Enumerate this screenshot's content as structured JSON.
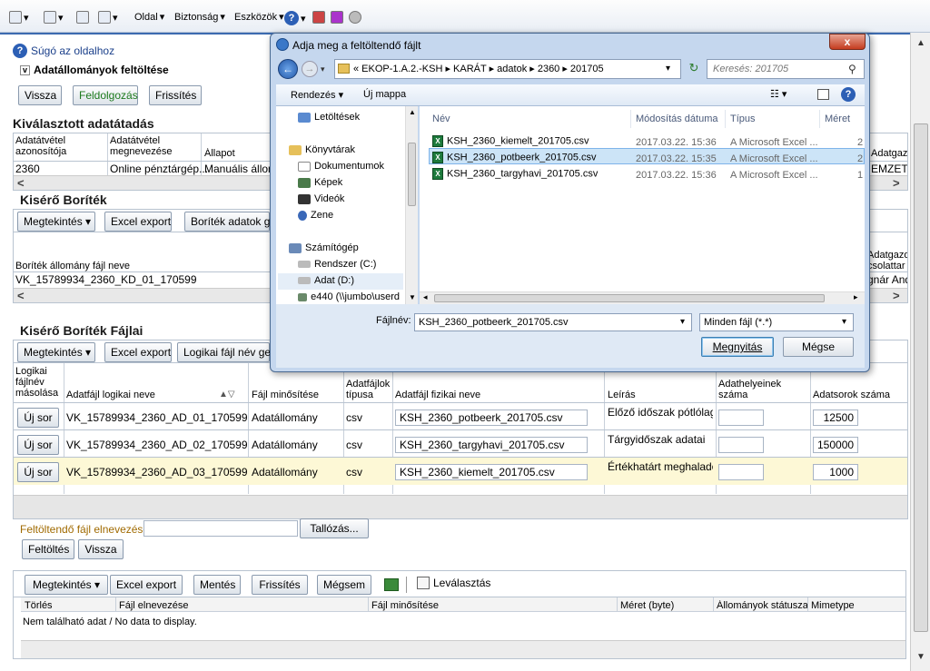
{
  "ie_toolbar": {
    "menus": [
      "Oldal",
      "Biztonság",
      "Eszközök"
    ]
  },
  "page": {
    "help_link": "Súgó az oldalhoz",
    "section_title": "Adatállományok feltöltése",
    "top_buttons": [
      "Vissza",
      "Feldolgozás",
      "Frissítés"
    ],
    "selected": {
      "title": "Kiválasztott adatátadás",
      "headers": [
        "Adatátvétel azonosítója",
        "Adatátvétel megnevezése",
        "Állapot",
        "Adatgazd"
      ],
      "row": [
        "2360",
        "Online pénztárgép...",
        "Manuális állom",
        "EMZETI"
      ]
    },
    "kisero": {
      "title": "Kisérő Boríték",
      "buttons": [
        "Megtekintés ▾",
        "Excel export",
        "Boríték adatok ge"
      ],
      "header": "Boríték állomány fájl neve",
      "header_right": "Adatgazda csolattar",
      "row": "VK_15789934_2360_KD_01_170599",
      "row_right": "gnár And"
    },
    "fajlai": {
      "title": "Kisérő Boríték Fájlai",
      "buttons": [
        "Megtekintés ▾",
        "Excel export",
        "Logikai fájl név gen"
      ],
      "headers": [
        "Logikai fájlnév másolása",
        "Adatfájl logikai neve",
        "Fájl minősítése",
        "Adatfájlok típusa",
        "Adatfájl fizikai neve",
        "Leírás",
        "Adathelyeinek száma",
        "Adatsorok száma"
      ],
      "rows": [
        {
          "btn": "Új sor",
          "logical": "VK_15789934_2360_AD_01_170599",
          "qual": "Adatállomány",
          "type": "csv",
          "physical": "KSH_2360_potbeerk_201705.csv",
          "desc": "Előző időszak pótlólagos",
          "places": "",
          "count": "12500"
        },
        {
          "btn": "Új sor",
          "logical": "VK_15789934_2360_AD_02_170599",
          "qual": "Adatállomány",
          "type": "csv",
          "physical": "KSH_2360_targyhavi_201705.csv",
          "desc": "Tárgyidőszak adatai",
          "places": "",
          "count": "150000"
        },
        {
          "btn": "Új sor",
          "logical": "VK_15789934_2360_AD_03_170599",
          "qual": "Adatállomány",
          "type": "csv",
          "physical": "KSH_2360_kiemelt_201705.csv",
          "desc": "Értékhatárt meghaladó",
          "places": "",
          "count": "1000"
        }
      ]
    },
    "upload": {
      "label": "Feltöltendő fájl elnevezése",
      "value": "",
      "browse": "Tallózás...",
      "buttons": [
        "Feltöltés",
        "Vissza"
      ]
    },
    "bottom": {
      "buttons": [
        "Megtekintés ▾",
        "Excel export",
        "Mentés",
        "Frissítés",
        "Mégsem"
      ],
      "detach": "Leválasztás",
      "headers": [
        "Törlés",
        "Fájl elnevezése",
        "Fájl minősítése",
        "Méret (byte)",
        "Állományok státusza",
        "Mimetype"
      ],
      "empty": "Nem található adat / No data to display."
    }
  },
  "dialog": {
    "title": "Adja meg a feltöltendő fájlt",
    "close": "x",
    "address": "« EKOP-1.A.2.-KSH  ▸  KARÁT  ▸  adatok  ▸  2360  ▸  201705",
    "search_placeholder": "Keresés: 201705",
    "cmd": [
      "Rendezés ▾",
      "Új mappa"
    ],
    "nav": [
      {
        "label": "Letöltések",
        "icon": "downloads-folder-icon"
      },
      {
        "label": "Könyvtárak",
        "icon": "libraries-icon"
      },
      {
        "label": "Dokumentumok",
        "icon": "documents-icon"
      },
      {
        "label": "Képek",
        "icon": "pictures-icon"
      },
      {
        "label": "Videók",
        "icon": "videos-icon"
      },
      {
        "label": "Zene",
        "icon": "music-icon"
      },
      {
        "label": "Számítógép",
        "icon": "computer-icon"
      },
      {
        "label": "Rendszer (C:)",
        "icon": "drive-icon"
      },
      {
        "label": "Adat (D:)",
        "icon": "drive-icon"
      },
      {
        "label": "e440 (\\\\jumbo\\userd",
        "icon": "network-drive-icon"
      }
    ],
    "columns": [
      "Név",
      "Módosítás dátuma",
      "Típus",
      "Méret"
    ],
    "files": [
      {
        "name": "KSH_2360_kiemelt_201705.csv",
        "date": "2017.03.22. 15:36",
        "type": "A Microsoft Excel ...",
        "size": "2"
      },
      {
        "name": "KSH_2360_potbeerk_201705.csv",
        "date": "2017.03.22. 15:35",
        "type": "A Microsoft Excel ...",
        "size": "2"
      },
      {
        "name": "KSH_2360_targyhavi_201705.csv",
        "date": "2017.03.22. 15:36",
        "type": "A Microsoft Excel ...",
        "size": "1"
      }
    ],
    "filename_label": "Fájlnév:",
    "filename_value": "KSH_2360_potbeerk_201705.csv",
    "filter": "Minden fájl (*.*)",
    "open": "Megnyitás",
    "cancel": "Mégse"
  }
}
